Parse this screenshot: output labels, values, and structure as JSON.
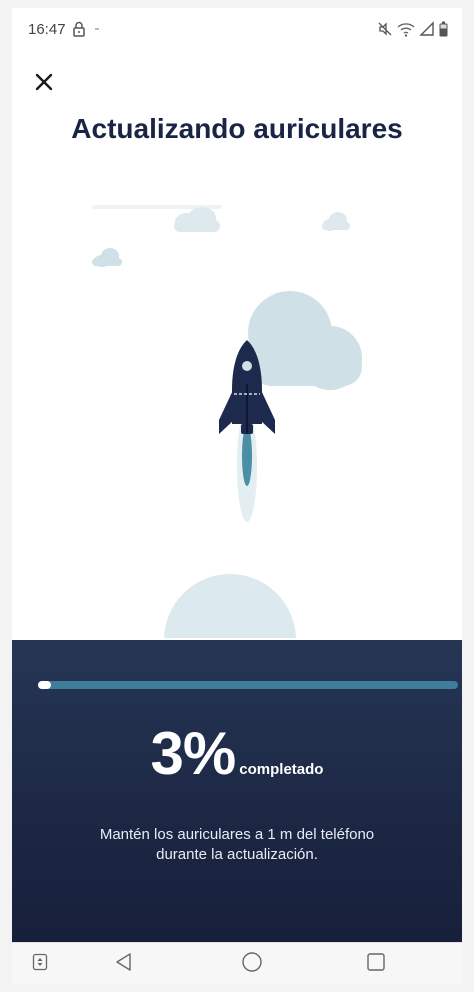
{
  "status_bar": {
    "time": "16:47",
    "icons": [
      "lock-icon",
      "mute-icon",
      "wifi-icon",
      "signal-icon",
      "battery-icon"
    ]
  },
  "header": {
    "close_icon": "close-icon",
    "title": "Actualizando auriculares"
  },
  "illustration": {
    "subject": "rocket-icon",
    "colors": {
      "rocket": "#1e2a4d",
      "cloud": "#cfe0e6",
      "flame": "#4a8fa6"
    }
  },
  "progress": {
    "fraction": 0.03,
    "percent_text": "3%",
    "label": "completado",
    "track_color": "#3e7e98",
    "fill_color": "#ffffff"
  },
  "hint": {
    "line1": "Mantén los auriculares a 1 m del teléfono",
    "line2": "durante la actualización."
  },
  "nav_bar": {
    "icons": [
      "rotate-icon",
      "back-icon",
      "home-icon",
      "recents-icon"
    ]
  },
  "colors": {
    "title": "#1a2546",
    "panel": "#1f2c4a"
  }
}
